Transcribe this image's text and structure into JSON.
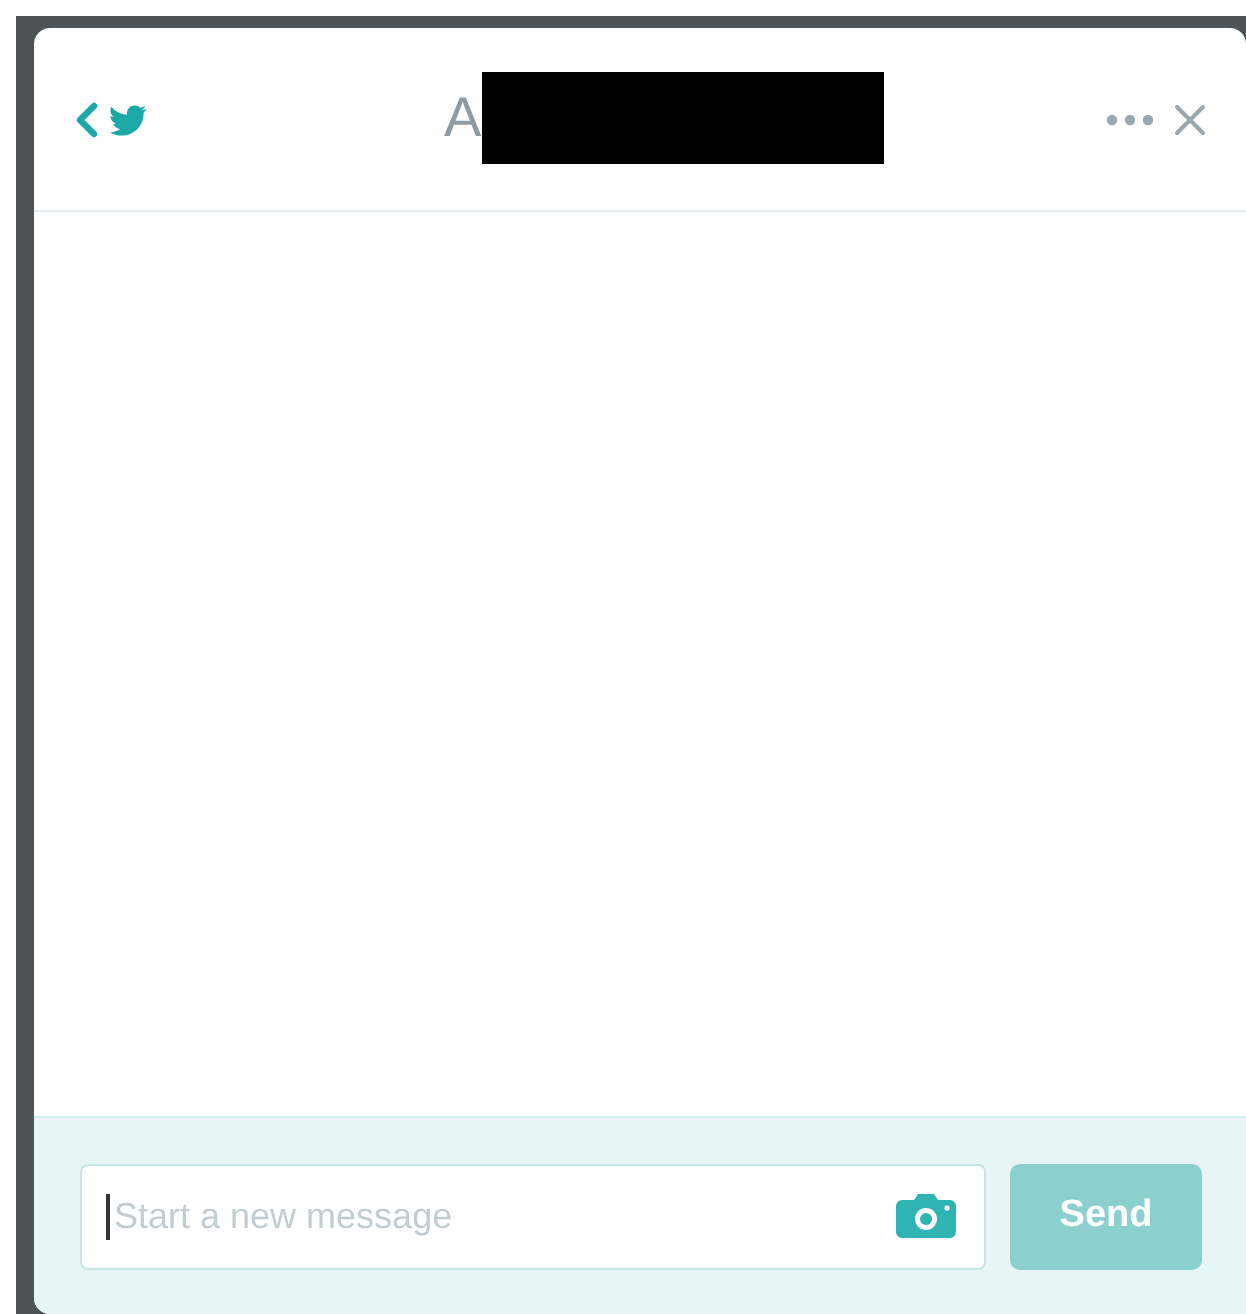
{
  "header": {
    "title": "A",
    "redacted": true
  },
  "composer": {
    "placeholder": "Start a new message"
  },
  "send_button": {
    "label": "Send",
    "disabled": true
  }
}
